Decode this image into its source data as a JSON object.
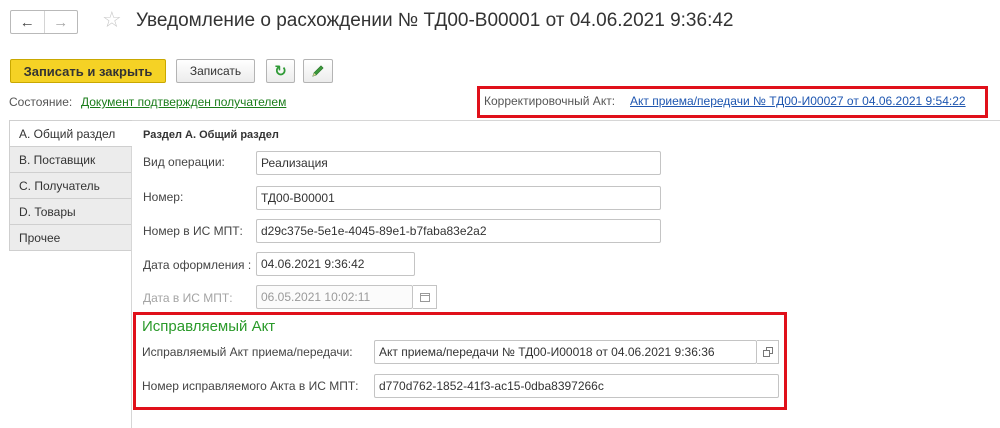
{
  "window": {
    "title": "Уведомление о расхождении № ТД00-В00001 от 04.06.2021 9:36:42",
    "nav_back": "←",
    "nav_forward": "→",
    "star_icon": "☆"
  },
  "toolbar": {
    "save_close_label": "Записать и закрыть",
    "save_label": "Записать",
    "refresh_icon": "refresh-icon",
    "edit_icon": "pencil-icon"
  },
  "status": {
    "label": "Состояние:",
    "value": "Документ подтвержден получателем",
    "corr_label": "Корректировочный Акт:",
    "corr_value": "Акт приема/передачи № ТД00-И00027 от 04.06.2021 9:54:22"
  },
  "tabs": [
    {
      "label": "А. Общий раздел",
      "active": true
    },
    {
      "label": "В. Поставщик",
      "active": false
    },
    {
      "label": "С. Получатель",
      "active": false
    },
    {
      "label": "D. Товары",
      "active": false
    },
    {
      "label": "Прочее",
      "active": false
    }
  ],
  "form": {
    "section_title": "Раздел А. Общий раздел",
    "operation_label": "Вид операции:",
    "operation_value": "Реализация",
    "number_label": "Номер:",
    "number_value": "ТД00-В00001",
    "mpt_number_label": "Номер в ИС МПТ:",
    "mpt_number_value": "d29c375e-5e1e-4045-89e1-b7faba83e2a2",
    "date_label": "Дата оформления :",
    "date_value": "04.06.2021  9:36:42",
    "mpt_date_label": "Дата в ИС МПТ:",
    "mpt_date_value": "06.05.2021 10:02:11"
  },
  "corrected_act": {
    "group_title": "Исправляемый Акт",
    "act_label": "Исправляемый Акт приема/передачи:",
    "act_value": "Акт приема/передачи № ТД00-И00018 от 04.06.2021 9:36:36",
    "act_mpt_label": "Номер исправляемого Акта в ИС МПТ:",
    "act_mpt_value": "d770d762-1852-41f3-ac15-0dba8397266c"
  },
  "colors": {
    "primary_button": "#f5d225",
    "highlight_border": "#e0101a",
    "green_link": "#1a7d1a",
    "blue_link": "#1e56b0",
    "group_title": "#2a9a2a"
  }
}
